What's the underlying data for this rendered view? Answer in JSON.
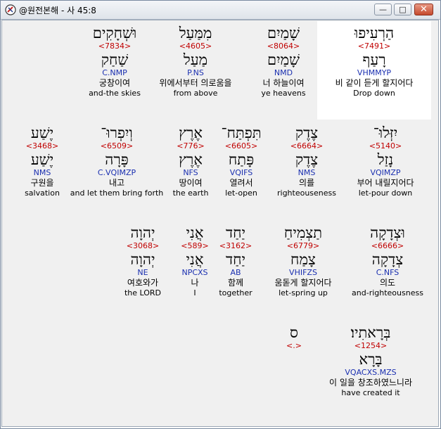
{
  "window": {
    "title": "@원전본해 - 사 45:8"
  },
  "rows": [
    {
      "words": [
        {
          "cx": 0,
          "text": "וּשְׁחָקִים",
          "strong": "<7834>",
          "lemma": "שַׁחַק",
          "morph": "C.NMP",
          "kor": "궁창이여",
          "eng": "and-the skies"
        },
        {
          "text": "מִמַּעַל",
          "strong": "<4605>",
          "lemma": "מַעַל",
          "morph": "P.NS",
          "kor": "위에서부터 의로움을",
          "eng": "from above"
        },
        {
          "text": "שָׁמַיִם",
          "strong": "<8064>",
          "lemma": "שָׁמַיִם",
          "morph": "NMD",
          "kor": "너 하늘이여",
          "eng": "ye heavens"
        },
        {
          "text": "הַרְעִיפוּ",
          "strong": "<7491>",
          "lemma": "רָעַף",
          "morph": "VHMMYP",
          "kor": "비 같이 듣게 할지어다",
          "eng": "Drop down"
        }
      ]
    },
    {
      "words": [
        {
          "text": "יֶשַׁע",
          "strong": "<3468>",
          "lemma": "יֶשַׁע",
          "morph": "NMS",
          "kor": "구원을",
          "eng": "salvation"
        },
        {
          "text": "וְיִפְרוּ־",
          "strong": "<6509>",
          "lemma": "פָּרָה",
          "morph": "C.VQIMZP",
          "kor": "내고",
          "eng": "and let them bring forth"
        },
        {
          "text": "אֶרֶץ",
          "strong": "<776>",
          "lemma": "אֶרֶץ",
          "morph": "NFS",
          "kor": "땅이여",
          "eng": "the earth"
        },
        {
          "text": "תִּפְתַּח־",
          "strong": "<6605>",
          "lemma": "פָּתַח",
          "morph": "VQIFS",
          "kor": "열려서",
          "eng": "let-open"
        },
        {
          "text": "צֶדֶק",
          "strong": "<6664>",
          "lemma": "צֶדֶק",
          "morph": "NMS",
          "kor": "의를",
          "eng": "righteouseness"
        },
        {
          "text": "יִזְּלוּ־",
          "strong": "<5140>",
          "lemma": "נָזַל",
          "morph": "VQIMZP",
          "kor": "부어 내릴지어다",
          "eng": "let-pour down"
        }
      ]
    },
    {
      "words": [
        {
          "text": "יְהוָה",
          "strong": "<3068>",
          "lemma": "יְהוָה",
          "morph": "NE",
          "kor": "여호와가",
          "eng": "the LORD"
        },
        {
          "text": "אֲנִי",
          "strong": "<589>",
          "lemma": "אֲנִי",
          "morph": "NPCXS",
          "kor": "나",
          "eng": "I"
        },
        {
          "text": "יַחַד",
          "strong": "<3162>",
          "lemma": "יַחַד",
          "morph": "AB",
          "kor": "함께",
          "eng": "together"
        },
        {
          "text": "תַצְמִיחַ",
          "strong": "<6779>",
          "lemma": "צָמַח",
          "morph": "VHIFZS",
          "kor": "움돋게 할지어다",
          "eng": "let-spring up"
        },
        {
          "text": "וּצְדָקָה",
          "strong": "<6666>",
          "lemma": "צְדָקָה",
          "morph": "C.NFS",
          "kor": "의도",
          "eng": "and-righteousness"
        }
      ]
    },
    {
      "words": [
        {
          "text": "ס",
          "strong": "<.>",
          "lemma": "",
          "morph": "",
          "kor": "",
          "eng": ""
        },
        {
          "text": "בְּרָאתִיו׃",
          "strong": "<1254>",
          "lemma": "בָּרָא",
          "morph": "VQACXS.MZS",
          "kor": "이 일을 창조하였느니라",
          "eng": "have created it"
        }
      ]
    }
  ]
}
